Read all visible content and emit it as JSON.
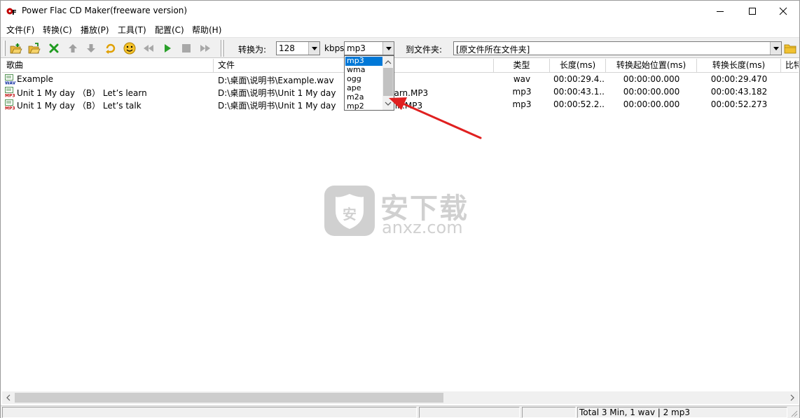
{
  "window": {
    "title": "Power Flac CD Maker(freeware version)"
  },
  "menu": [
    "文件(F)",
    "转换(C)",
    "播放(P)",
    "工具(T)",
    "配置(C)",
    "帮助(H)"
  ],
  "toolbar": {
    "convert_to_label": "转换为:",
    "bitrate_value": "128",
    "kbps_label": "kbps",
    "format_value": "mp3",
    "to_folder_label": "到文件夹:",
    "folder_value": "[原文件所在文件夹]"
  },
  "format_options": [
    "mp3",
    "wma",
    "ogg",
    "ape",
    "m2a",
    "mp2"
  ],
  "columns": [
    "歌曲",
    "文件",
    "类型",
    "长度(ms)",
    "转换起始位置(ms)",
    "转换长度(ms)",
    "比特"
  ],
  "rows": [
    {
      "icon": "wav",
      "song": "Example",
      "file": "D:\\桌面\\说明书\\Example.wav",
      "type": "wav",
      "length": "00:00:29.4...",
      "start": "00:00:00.000",
      "conv_length": "00:00:29.470"
    },
    {
      "icon": "mp3",
      "song": "Unit 1 My day （B） Let’s learn",
      "file": "D:\\桌面\\说明书\\Unit 1 My day （B） Let’s learn.MP3",
      "type": "mp3",
      "length": "00:00:43.1...",
      "start": "00:00:00.000",
      "conv_length": "00:00:43.182"
    },
    {
      "icon": "mp3",
      "song": "Unit 1 My day （B） Let’s talk",
      "file": "D:\\桌面\\说明书\\Unit 1 My day （B） Let’s talk.MP3",
      "type": "mp3",
      "length": "00:00:52.2...",
      "start": "00:00:00.000",
      "conv_length": "00:00:52.273"
    }
  ],
  "watermark": {
    "text": "安下载",
    "url": "anxz.com"
  },
  "status": {
    "summary": "Total 3 Min, 1 wav | 2 mp3"
  },
  "colors": {
    "selection": "#0078d7",
    "arrow": "#e02020",
    "play_green": "#2aa02a",
    "delete_green": "#1f9b1f"
  }
}
